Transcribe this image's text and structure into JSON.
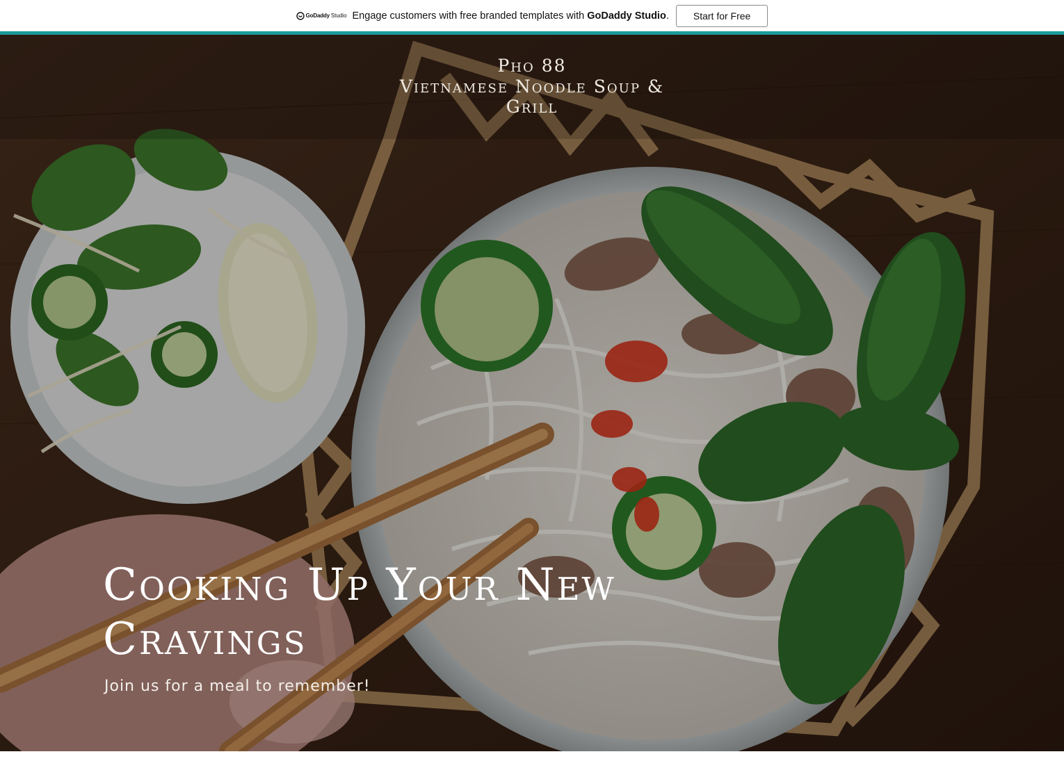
{
  "promo": {
    "logo_text": "GoDaddy",
    "logo_sub": "Studio",
    "message": "Engage customers with free branded templates with ",
    "brand": "GoDaddy Studio",
    "period": ".",
    "cta_label": "Start for Free"
  },
  "site": {
    "name_line1": "Pho 88",
    "name_line2": "Vietnamese Noodle Soup & Grill"
  },
  "hero": {
    "headline": "Cooking Up Your New Cravings",
    "tagline": "Join us for a meal to remember!",
    "image_subject": "bowl-of-pho-with-chopsticks-photo"
  },
  "colors": {
    "accent": "#1a9c9b",
    "hero_text": "#ffffff",
    "wood": "#3a2618"
  }
}
